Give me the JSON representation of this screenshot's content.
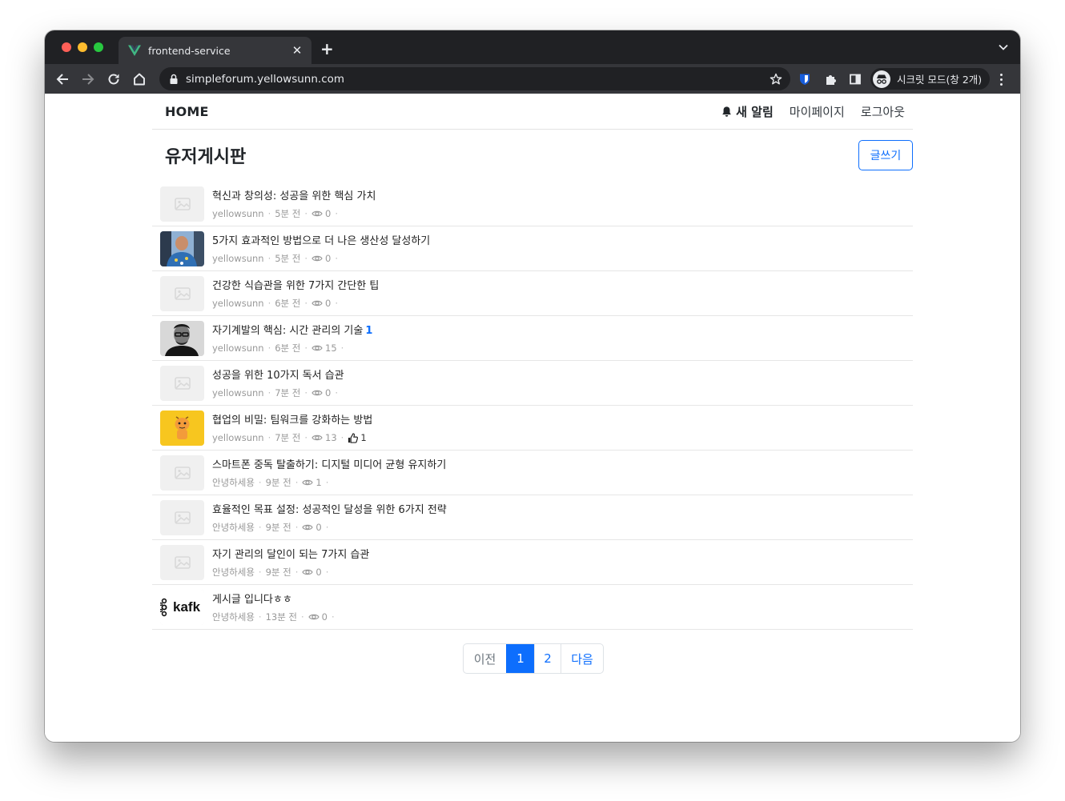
{
  "browser": {
    "tab_title": "frontend-service",
    "url": "simpleforum.yellowsunn.com",
    "incognito_label": "시크릿 모드(창 2개)",
    "traffic_lights": [
      "#ff5f57",
      "#febc2e",
      "#28c840"
    ]
  },
  "navbar": {
    "brand": "HOME",
    "notifications": "새 알림",
    "mypage": "마이페이지",
    "logout": "로그아웃"
  },
  "board": {
    "title": "유저게시판",
    "write_button": "글쓰기"
  },
  "posts": [
    {
      "title": "혁신과 창의성: 성공을 위한 핵심 가치",
      "comments": "",
      "author": "yellowsunn",
      "time": "5분 전",
      "views": "0",
      "likes": "",
      "thumb": "placeholder"
    },
    {
      "title": "5가지 효과적인 방법으로 더 나은 생산성 달성하기",
      "comments": "",
      "author": "yellowsunn",
      "time": "5분 전",
      "views": "0",
      "likes": "",
      "thumb": "person-photo"
    },
    {
      "title": "건강한 식습관을 위한 7가지 간단한 팁",
      "comments": "",
      "author": "yellowsunn",
      "time": "6분 전",
      "views": "0",
      "likes": "",
      "thumb": "placeholder"
    },
    {
      "title": "자기계발의 핵심: 시간 관리의 기술",
      "comments": "1",
      "author": "yellowsunn",
      "time": "6분 전",
      "views": "15",
      "likes": "",
      "thumb": "bw-portrait"
    },
    {
      "title": "성공을 위한 10가지 독서 습관",
      "comments": "",
      "author": "yellowsunn",
      "time": "7분 전",
      "views": "0",
      "likes": "",
      "thumb": "placeholder"
    },
    {
      "title": "협업의 비밀: 팀워크를 강화하는 방법",
      "comments": "",
      "author": "yellowsunn",
      "time": "7분 전",
      "views": "13",
      "likes": "1",
      "thumb": "character"
    },
    {
      "title": "스마트폰 중독 탈출하기: 디지털 미디어 균형 유지하기",
      "comments": "",
      "author": "안녕하세용",
      "time": "9분 전",
      "views": "1",
      "likes": "",
      "thumb": "placeholder"
    },
    {
      "title": "효율적인 목표 설정: 성공적인 달성을 위한 6가지 전략",
      "comments": "",
      "author": "안녕하세용",
      "time": "9분 전",
      "views": "0",
      "likes": "",
      "thumb": "placeholder"
    },
    {
      "title": "자기 관리의 달인이 되는 7가지 습관",
      "comments": "",
      "author": "안녕하세용",
      "time": "9분 전",
      "views": "0",
      "likes": "",
      "thumb": "placeholder"
    },
    {
      "title": "게시글 입니다ㅎㅎ",
      "comments": "",
      "author": "안녕하세용",
      "time": "13분 전",
      "views": "0",
      "likes": "",
      "thumb": "kafka-logo",
      "thumb_text": "kafk"
    }
  ],
  "pagination": {
    "prev": "이전",
    "pages": [
      "1",
      "2"
    ],
    "current": "1",
    "next": "다음"
  },
  "colors": {
    "primary": "#0d6efd",
    "chrome_dark": "#202124",
    "chrome_toolbar": "#35363a"
  }
}
